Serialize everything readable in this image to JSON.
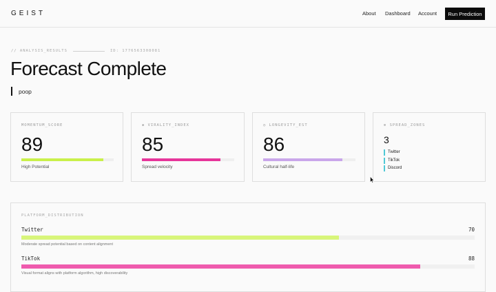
{
  "nav": {
    "logo": "GEIST",
    "links": [
      "About",
      "Dashboard",
      "Account"
    ],
    "cta": "Run Prediction"
  },
  "header": {
    "breadcrumb": "// ANALYSIS_RESULTS",
    "id": "ID: 1776563308081",
    "title": "Forecast Complete",
    "query": "poop"
  },
  "cards": [
    {
      "label": "MOMENTUM_SCORE",
      "value": "89",
      "progress": 0.89,
      "color": "#c9f04a",
      "subtitle": "High Potential"
    },
    {
      "label": "◈ VIRALITY_INDEX",
      "value": "85",
      "progress": 0.85,
      "color": "#e6359a",
      "subtitle": "Spread velocity"
    },
    {
      "label": "◷ LONGEVITY_EST",
      "value": "86",
      "progress": 0.86,
      "color": "#c9a6ea",
      "subtitle": "Cultural half-life"
    }
  ],
  "spread": {
    "label": "⊕ SPREAD_ZONES",
    "value": "3",
    "zones": [
      "Twitter",
      "TikTok",
      "Discord"
    ],
    "zone_color": "#4fc8d6"
  },
  "distribution": {
    "label": "PLATFORM_DISTRIBUTION",
    "platforms": [
      {
        "name": "Twitter",
        "value": "70",
        "progress": 0.7,
        "color": "#d8f57a",
        "description": "Moderate spread potential based on content alignment"
      },
      {
        "name": "TikTok",
        "value": "88",
        "progress": 0.88,
        "color": "#ef5bae",
        "description": "Visual format aligns with platform algorithm, high discoverability"
      }
    ]
  }
}
